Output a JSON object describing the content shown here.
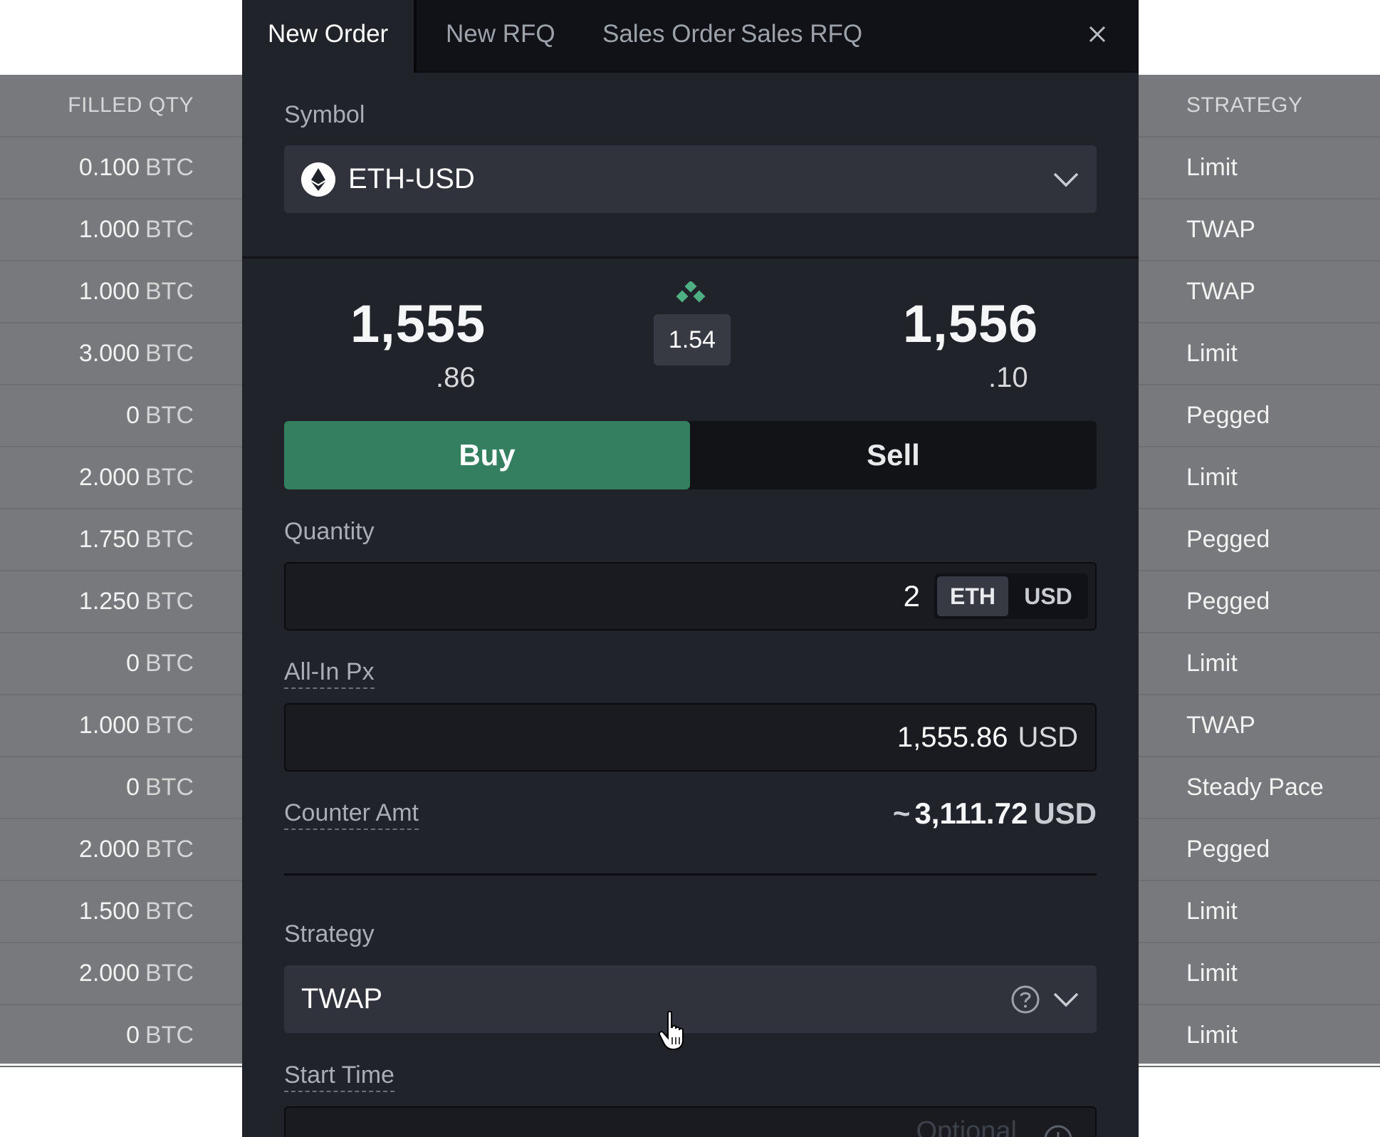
{
  "background": {
    "left_header": "FILLED QTY",
    "right_header": "STRATEGY",
    "rows": [
      {
        "qty": "0.100",
        "unit": "BTC",
        "strategy": "Limit"
      },
      {
        "qty": "1.000",
        "unit": "BTC",
        "strategy": "TWAP"
      },
      {
        "qty": "1.000",
        "unit": "BTC",
        "strategy": "TWAP"
      },
      {
        "qty": "3.000",
        "unit": "BTC",
        "strategy": "Limit"
      },
      {
        "qty": "0",
        "unit": "BTC",
        "strategy": "Pegged"
      },
      {
        "qty": "2.000",
        "unit": "BTC",
        "strategy": "Limit"
      },
      {
        "qty": "1.750",
        "unit": "BTC",
        "strategy": "Pegged"
      },
      {
        "qty": "1.250",
        "unit": "BTC",
        "strategy": "Pegged"
      },
      {
        "qty": "0",
        "unit": "BTC",
        "strategy": "Limit"
      },
      {
        "qty": "1.000",
        "unit": "BTC",
        "strategy": "TWAP"
      },
      {
        "qty": "0",
        "unit": "BTC",
        "strategy": "Steady Pace"
      },
      {
        "qty": "2.000",
        "unit": "BTC",
        "strategy": "Pegged"
      },
      {
        "qty": "1.500",
        "unit": "BTC",
        "strategy": "Limit"
      },
      {
        "qty": "2.000",
        "unit": "BTC",
        "strategy": "Limit"
      },
      {
        "qty": "0",
        "unit": "BTC",
        "strategy": "Limit"
      }
    ]
  },
  "modal": {
    "tabs": [
      {
        "label": "New Order",
        "active": true
      },
      {
        "label": "New RFQ",
        "active": false
      },
      {
        "label": "Sales Order",
        "active": false
      },
      {
        "label": "Sales RFQ",
        "active": false
      }
    ],
    "symbol": {
      "label": "Symbol",
      "value": "ETH-USD",
      "icon": "ethereum-icon"
    },
    "prices": {
      "bid_big": "1,555",
      "bid_small": ".86",
      "spread": "1.54",
      "offer_big": "1,556",
      "offer_small": ".10"
    },
    "side": {
      "buy_label": "Buy",
      "sell_label": "Sell",
      "selected": "Buy"
    },
    "quantity": {
      "label": "Quantity",
      "value": "2",
      "units": [
        "ETH",
        "USD"
      ],
      "selected_unit": "ETH"
    },
    "all_in_px": {
      "label": "All-In Px",
      "value": "1,555.86",
      "unit": "USD"
    },
    "counter_amt": {
      "label": "Counter Amt",
      "tilde": "~",
      "value": "3,111.72",
      "unit": "USD"
    },
    "strategy": {
      "label": "Strategy",
      "value": "TWAP"
    },
    "start_time": {
      "label": "Start Time",
      "placeholder": "Optional"
    }
  },
  "colors": {
    "accent_green": "#337f5f",
    "spread_icon": "#4fae84",
    "modal_bg": "#20232a",
    "overlay_gray": "#77797c"
  }
}
